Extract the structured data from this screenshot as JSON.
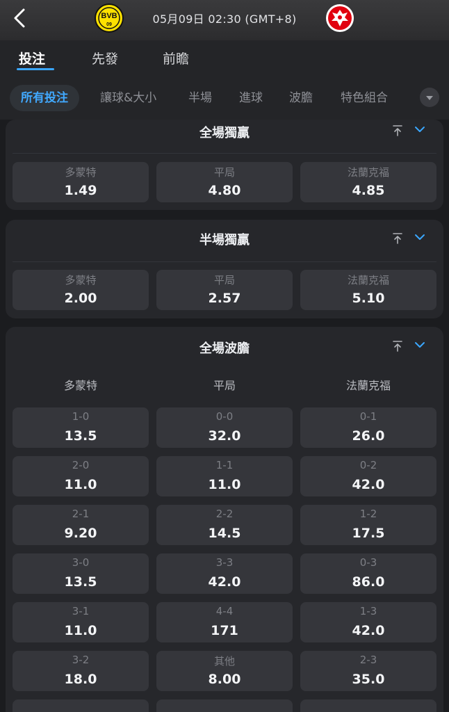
{
  "header": {
    "match_time": "05月09日 02:30 (GMT+8)",
    "home_logo_text": "BVB",
    "home_logo_sub": "09",
    "back_icon": "chevron-left-icon"
  },
  "tabs": [
    {
      "label": "投注",
      "active": true
    },
    {
      "label": "先發",
      "active": false
    },
    {
      "label": "前瞻",
      "active": false
    }
  ],
  "filters": [
    "所有投注",
    "讓球&大小",
    "半場",
    "進球",
    "波膽",
    "特色組合"
  ],
  "markets": {
    "fulltime": {
      "title": "全場獨贏",
      "odds": [
        {
          "label": "多蒙特",
          "value": "1.49"
        },
        {
          "label": "平局",
          "value": "4.80"
        },
        {
          "label": "法蘭克福",
          "value": "4.85"
        }
      ]
    },
    "halftime": {
      "title": "半場獨贏",
      "odds": [
        {
          "label": "多蒙特",
          "value": "2.00"
        },
        {
          "label": "平局",
          "value": "2.57"
        },
        {
          "label": "法蘭克福",
          "value": "5.10"
        }
      ]
    },
    "correct_score": {
      "title": "全場波膽",
      "columns": [
        "多蒙特",
        "平局",
        "法蘭克福"
      ],
      "rows": [
        [
          {
            "label": "1-0",
            "value": "13.5"
          },
          {
            "label": "0-0",
            "value": "32.0"
          },
          {
            "label": "0-1",
            "value": "26.0"
          }
        ],
        [
          {
            "label": "2-0",
            "value": "11.0"
          },
          {
            "label": "1-1",
            "value": "11.0"
          },
          {
            "label": "0-2",
            "value": "42.0"
          }
        ],
        [
          {
            "label": "2-1",
            "value": "9.20"
          },
          {
            "label": "2-2",
            "value": "14.5"
          },
          {
            "label": "1-2",
            "value": "17.5"
          }
        ],
        [
          {
            "label": "3-0",
            "value": "13.5"
          },
          {
            "label": "3-3",
            "value": "42.0"
          },
          {
            "label": "0-3",
            "value": "86.0"
          }
        ],
        [
          {
            "label": "3-1",
            "value": "11.0"
          },
          {
            "label": "4-4",
            "value": "171"
          },
          {
            "label": "1-3",
            "value": "42.0"
          }
        ],
        [
          {
            "label": "3-2",
            "value": "18.0"
          },
          {
            "label": "其他",
            "value": "8.00"
          },
          {
            "label": "2-3",
            "value": "35.0"
          }
        ]
      ]
    }
  },
  "colors": {
    "accent": "#3aa7ff",
    "background": "#1b1c1f",
    "card": "#26272b",
    "odds_box": "#35363b"
  }
}
